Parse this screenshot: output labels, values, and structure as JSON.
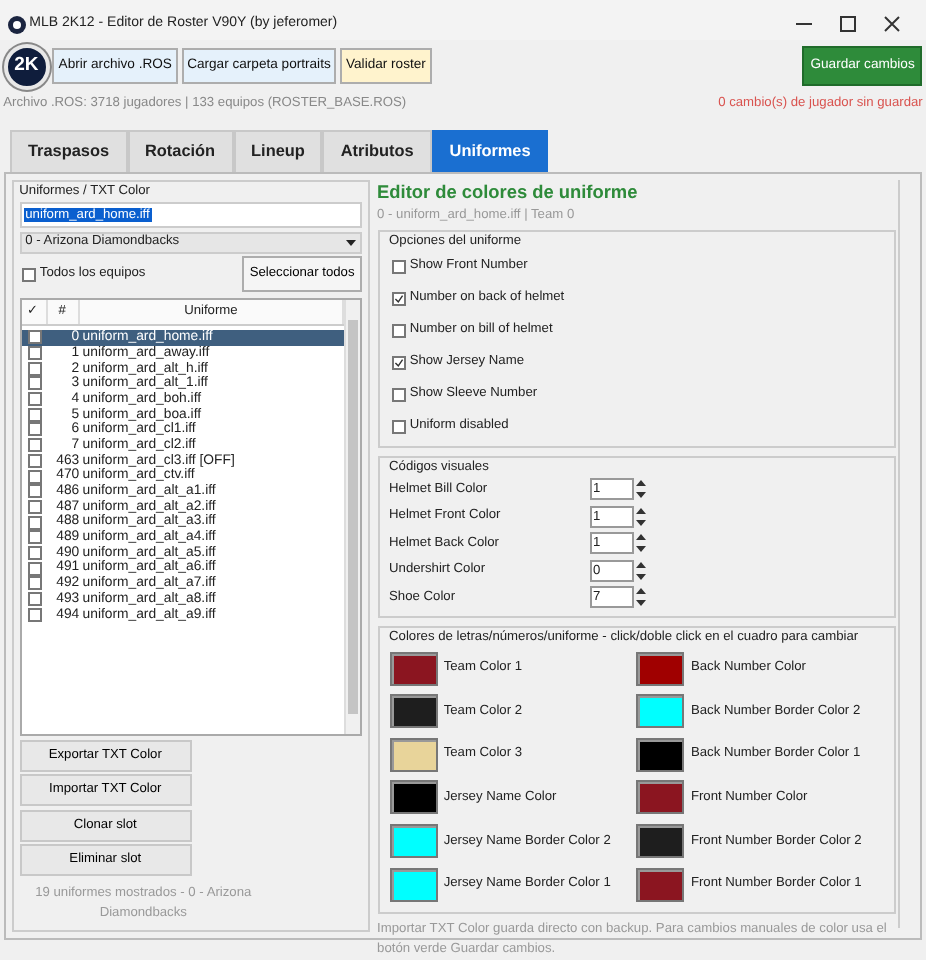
{
  "window": {
    "title": "MLB 2K12 - Editor de Roster V90Y (by jeferomer)"
  },
  "toolbar": {
    "logo": "2K",
    "buttons": [
      {
        "label": "Abrir archivo .ROS",
        "kind": "plain"
      },
      {
        "label": "Cargar carpeta portraits",
        "kind": "plain"
      },
      {
        "label": "Validar roster",
        "kind": "warning"
      }
    ],
    "save_button": "Guardar cambios"
  },
  "info": {
    "file": "Archivo .ROS: 3718 jugadores | 133 equipos (ROSTER_BASE.ROS)",
    "unsaved": "0 cambio(s) de jugador sin guardar"
  },
  "tabs": [
    {
      "label": "Traspasos",
      "selected": false
    },
    {
      "label": "Rotación",
      "selected": false
    },
    {
      "label": "Lineup",
      "selected": false
    },
    {
      "label": "Atributos",
      "selected": false
    },
    {
      "label": "Uniformes",
      "selected": true
    }
  ],
  "left": {
    "group_title": "Uniformes / TXT Color",
    "name_field": "uniform_ard_home.iff",
    "team_select": "0 - Arizona Diamondbacks",
    "all_teams": {
      "label": "Todos los equipos",
      "checked": false
    },
    "select_all": "Seleccionar todos",
    "columns": [
      "✓",
      "#",
      "Uniforme"
    ],
    "rows": [
      {
        "checked": false,
        "number": "0",
        "name": "uniform_ard_home.iff",
        "selected": true
      },
      {
        "checked": false,
        "number": "1",
        "name": "uniform_ard_away.iff",
        "selected": false
      },
      {
        "checked": false,
        "number": "2",
        "name": "uniform_ard_alt_h.iff",
        "selected": false
      },
      {
        "checked": false,
        "number": "3",
        "name": "uniform_ard_alt_1.iff",
        "selected": false
      },
      {
        "checked": false,
        "number": "4",
        "name": "uniform_ard_boh.iff",
        "selected": false
      },
      {
        "checked": false,
        "number": "5",
        "name": "uniform_ard_boa.iff",
        "selected": false
      },
      {
        "checked": false,
        "number": "6",
        "name": "uniform_ard_cl1.iff",
        "selected": false
      },
      {
        "checked": false,
        "number": "7",
        "name": "uniform_ard_cl2.iff",
        "selected": false
      },
      {
        "checked": false,
        "number": "463",
        "name": "uniform_ard_cl3.iff [OFF]",
        "selected": false
      },
      {
        "checked": false,
        "number": "470",
        "name": "uniform_ard_ctv.iff",
        "selected": false
      },
      {
        "checked": false,
        "number": "486",
        "name": "uniform_ard_alt_a1.iff",
        "selected": false
      },
      {
        "checked": false,
        "number": "487",
        "name": "uniform_ard_alt_a2.iff",
        "selected": false
      },
      {
        "checked": false,
        "number": "488",
        "name": "uniform_ard_alt_a3.iff",
        "selected": false
      },
      {
        "checked": false,
        "number": "489",
        "name": "uniform_ard_alt_a4.iff",
        "selected": false
      },
      {
        "checked": false,
        "number": "490",
        "name": "uniform_ard_alt_a5.iff",
        "selected": false
      },
      {
        "checked": false,
        "number": "491",
        "name": "uniform_ard_alt_a6.iff",
        "selected": false
      },
      {
        "checked": false,
        "number": "492",
        "name": "uniform_ard_alt_a7.iff",
        "selected": false
      },
      {
        "checked": false,
        "number": "493",
        "name": "uniform_ard_alt_a8.iff",
        "selected": false
      },
      {
        "checked": false,
        "number": "494",
        "name": "uniform_ard_alt_a9.iff",
        "selected": false
      }
    ],
    "buttons": [
      "Exportar TXT Color",
      "Importar TXT Color",
      "Clonar slot",
      "Eliminar slot"
    ],
    "status": "19 uniformes mostrados - 0 - Arizona Diamondbacks"
  },
  "right": {
    "title": "Editor de colores de uniforme",
    "subtitle": "0 - uniform_ard_home.iff  | Team 0",
    "options": {
      "title": "Opciones del uniforme",
      "items": [
        {
          "label": "Show Front Number",
          "checked": false
        },
        {
          "label": "Number on back of helmet",
          "checked": true
        },
        {
          "label": "Number on bill of helmet",
          "checked": false
        },
        {
          "label": "Show Jersey Name",
          "checked": true
        },
        {
          "label": "Show Sleeve Number",
          "checked": false
        },
        {
          "label": "Uniform disabled",
          "checked": false
        }
      ]
    },
    "codes": {
      "title": "Códigos visuales",
      "items": [
        {
          "label": "Helmet Bill Color",
          "value": "1"
        },
        {
          "label": "Helmet Front Color",
          "value": "1"
        },
        {
          "label": "Helmet Back Color",
          "value": "1"
        },
        {
          "label": "Undershirt Color",
          "value": "0"
        },
        {
          "label": "Shoe Color",
          "value": "7"
        }
      ]
    },
    "colors": {
      "title": "Colores de letras/números/uniforme - click/doble click en el cuadro para cambiar",
      "items": [
        {
          "label": "Team Color 1",
          "color": "#8b1520"
        },
        {
          "label": "Back Number Color",
          "color": "#a00000"
        },
        {
          "label": "Team Color 2",
          "color": "#1e1e1e"
        },
        {
          "label": "Back Number Border Color 2",
          "color": "#00ffff"
        },
        {
          "label": "Team Color 3",
          "color": "#e8d49a"
        },
        {
          "label": "Back Number Border Color 1",
          "color": "#000000"
        },
        {
          "label": "Jersey Name Color",
          "color": "#000000"
        },
        {
          "label": "Front Number Color",
          "color": "#8b1520"
        },
        {
          "label": "Jersey Name Border Color 2",
          "color": "#00ffff"
        },
        {
          "label": "Front Number Border Color 2",
          "color": "#1e1e1e"
        },
        {
          "label": "Jersey Name Border Color 1",
          "color": "#00ffff"
        },
        {
          "label": "Front Number Border Color 1",
          "color": "#8b1520"
        }
      ]
    },
    "note": "Importar TXT Color guarda directo con backup. Para cambios manuales de color usa el botón verde Guardar cambios."
  }
}
